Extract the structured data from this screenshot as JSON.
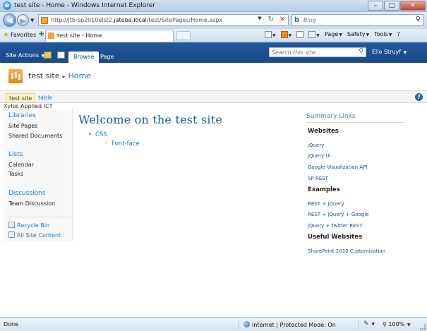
{
  "window": {
    "title": "test site - Home - Windows Internet Explorer",
    "minimize": "–",
    "maximize": "□",
    "close": "✕"
  },
  "addressbar": {
    "url_prefix": "http://jtb-sp2010elst2.",
    "url_domain": "jatoba.local",
    "url_path": "/test/SitePages/Home.aspx",
    "search_placeholder": "Bing",
    "refresh_icon": "refresh-icon",
    "stop_icon": "stop-icon"
  },
  "favbar": {
    "favorites_label": "Favorites",
    "tab_label": "test site - Home",
    "commands": {
      "page": "Page",
      "safety": "Safety",
      "tools": "Tools",
      "help": "?"
    }
  },
  "ribbon": {
    "site_actions": "Site Actions",
    "tabs": [
      "Browse",
      "Page"
    ],
    "search_placeholder": "Search this site...",
    "user": "Elio Struyf",
    "bar_color": "#1e5294"
  },
  "site": {
    "name": "test site",
    "page": "Home",
    "nav": [
      "test site",
      "table"
    ],
    "company": "Xylos Applied ICT"
  },
  "quicklaunch": {
    "sections": [
      {
        "heading": "Libraries",
        "items": [
          "Site Pages",
          "Shared Documents"
        ]
      },
      {
        "heading": "Lists",
        "items": [
          "Calendar",
          "Tasks"
        ]
      },
      {
        "heading": "Discussions",
        "items": [
          "Team Discussion"
        ]
      }
    ],
    "recycle_bin": "Recycle Bin",
    "all_content": "All Site Content"
  },
  "main": {
    "title": "Welcome on the test site",
    "bullet": "CSS",
    "sub_bullet": "Font-face"
  },
  "summary": {
    "title": "Summary Links",
    "groups": [
      {
        "heading": "Websites",
        "links": [
          "jQuery",
          "jQuery UI",
          "Google Visualization API",
          "SP REST"
        ]
      },
      {
        "heading": "Examples",
        "links": [
          "REST + jQuery",
          "REST + jQuery + Google",
          "jQuery + Twitter REST"
        ]
      },
      {
        "heading": "Useful Websites",
        "links": [
          "SharePoint 2010 Customization"
        ]
      }
    ]
  },
  "status": {
    "left": "Done",
    "zone": "Internet | Protected Mode: On",
    "zoom": "100%"
  }
}
